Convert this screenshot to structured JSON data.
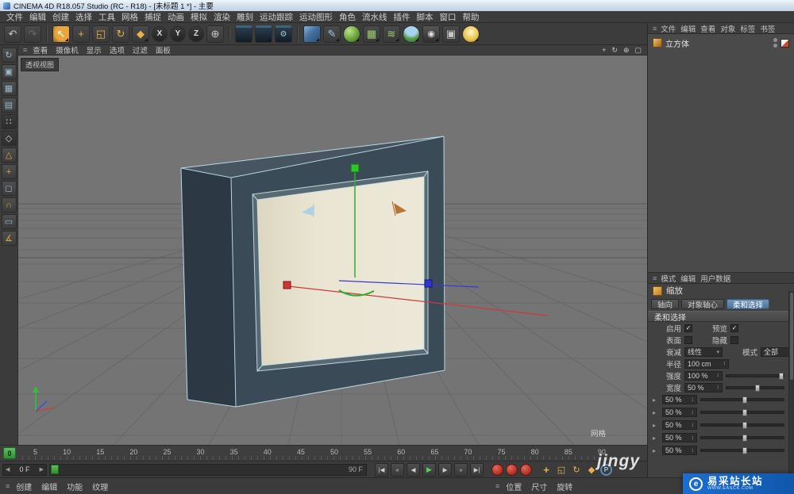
{
  "window": {
    "title": "CINEMA 4D R18.057 Studio (RC - R18) - [未标题 1 *] - 主要"
  },
  "menu_bar": {
    "items": [
      "文件",
      "编辑",
      "创建",
      "选择",
      "工具",
      "网格",
      "捕捉",
      "动画",
      "模拟",
      "渲染",
      "雕刻",
      "运动跟踪",
      "运动图形",
      "角色",
      "流水线",
      "插件",
      "脚本",
      "窗口",
      "帮助"
    ]
  },
  "icons": {
    "burger": "≡",
    "undo": "↶",
    "redo": "↷",
    "select": "↖",
    "move": "+",
    "scale": "◱",
    "rotate": "↻",
    "last_tool": "◆",
    "globe": "⊕",
    "gear": "⚙",
    "pen": "✎",
    "grid_green": "▦",
    "wave": "≋",
    "camera": "◉",
    "layout": "▣",
    "check": "✓",
    "dropdown": "▾",
    "updown": "↕",
    "spin_left": "◀",
    "spin_right": "▶",
    "pan": "+",
    "orbit": "↻",
    "zoom_view": "⊕",
    "maximize": "▢",
    "expander": "▸",
    "go_start": "|◀",
    "prev_key": "«",
    "prev_frame": "◀",
    "play": "▶",
    "next_frame": "▶",
    "next_key": "»",
    "go_end": "▶|",
    "key_pos": "+",
    "key_scale": "◱",
    "key_rot": "↻",
    "key_param": "◆",
    "autokey_p": "P"
  },
  "toolbar": {
    "axis_locks": [
      "X",
      "Y",
      "Z"
    ]
  },
  "left_toolbar": {
    "tools": [
      {
        "name": "make-editable-icon",
        "glyph": "↻",
        "tint": "t-steel"
      },
      {
        "name": "model-mode-icon",
        "glyph": "▣",
        "tint": "t-steel"
      },
      {
        "name": "texture-mode-icon",
        "glyph": "▦",
        "tint": "t-steel"
      },
      {
        "name": "workplane-mode-icon",
        "glyph": "▤",
        "tint": "t-steel"
      },
      {
        "name": "points-mode-icon",
        "glyph": "∷",
        "tint": "t-dark"
      },
      {
        "name": "edges-mode-icon",
        "glyph": "◇",
        "tint": "t-dark"
      },
      {
        "name": "polygons-mode-icon",
        "glyph": "△",
        "tint": "t-gold"
      },
      {
        "name": "enable-axis-icon",
        "glyph": "+",
        "tint": "t-gold"
      },
      {
        "name": "viewport-solo-icon",
        "glyph": "◻",
        "tint": "t-steel"
      },
      {
        "name": "snap-icon",
        "glyph": "∩",
        "tint": "t-gold"
      },
      {
        "name": "lock-workplane-icon",
        "glyph": "▭",
        "tint": "t-steel"
      },
      {
        "name": "quantize-icon",
        "glyph": "∡",
        "tint": "t-gold"
      }
    ]
  },
  "viewport": {
    "menus": [
      "查看",
      "摄像机",
      "显示",
      "选项",
      "过滤",
      "面板"
    ],
    "view_label": "透视视图",
    "hud_grid_label": "网格",
    "watermark": "jingy"
  },
  "object_manager": {
    "menus": [
      "文件",
      "编辑",
      "查看",
      "对象",
      "标签",
      "书签"
    ],
    "object_name": "立方体"
  },
  "attribute_manager": {
    "menus": [
      "模式",
      "编辑",
      "用户数据"
    ],
    "tool_name": "缩放",
    "tabs": [
      "轴向",
      "对象轴心",
      "柔和选择"
    ],
    "section_title": "柔和选择",
    "labels": {
      "enable": "启用",
      "preview": "预览",
      "surface": "表面",
      "hidden": "隐藏",
      "falloff": "衰减",
      "mode": "模式",
      "radius": "半径",
      "strength": "强度",
      "width": "宽度"
    },
    "values": {
      "falloff": "线性",
      "mode": "全部",
      "radius": "100 cm",
      "strength": "100 %",
      "width": "50 %"
    },
    "falloff_rows": [
      "50 %",
      "50 %",
      "50 %",
      "50 %",
      "50 %"
    ]
  },
  "timeline": {
    "playhead": "0",
    "ticks": [
      "5",
      "10",
      "15",
      "20",
      "25",
      "30",
      "35",
      "40",
      "45",
      "50",
      "55",
      "60",
      "65",
      "70",
      "75",
      "80",
      "85",
      "90"
    ],
    "current_frame": "0 F",
    "end_frame": "90 F"
  },
  "material_manager": {
    "menus": [
      "创建",
      "编辑",
      "功能",
      "纹理"
    ]
  },
  "coordinates_manager": {
    "menus": [
      "位置",
      "尺寸",
      "旋转"
    ]
  },
  "badge": {
    "logo_letter": "e",
    "title": "易采站长站",
    "subtitle": "WWW.EASCK.COM"
  }
}
